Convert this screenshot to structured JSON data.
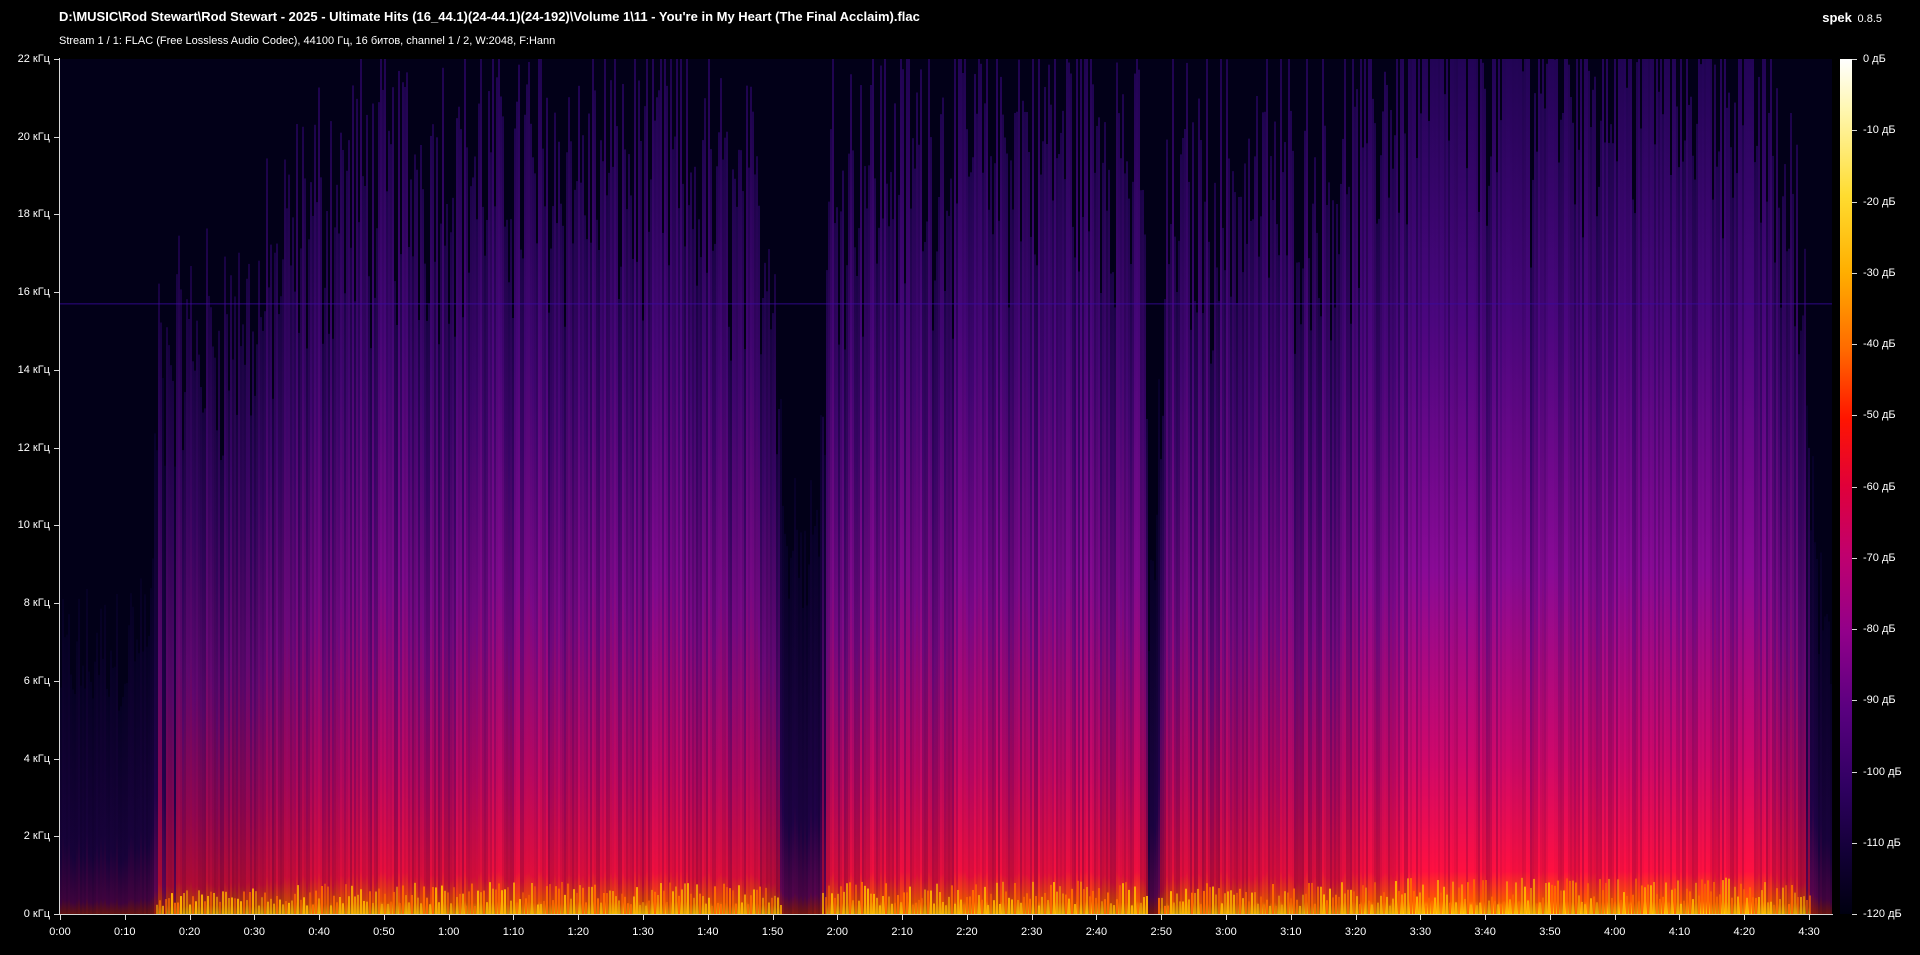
{
  "window": {
    "file_path": "D:\\MUSIC\\Rod Stewart\\Rod Stewart - 2025 - Ultimate Hits (16_44.1)(24-44.1)(24-192)\\Volume 1\\11 - You're in My Heart (The Final Acclaim).flac",
    "app_name": "spek",
    "app_version": "0.8.5",
    "stream_info": "Stream 1 / 1: FLAC (Free Lossless Audio Codec), 44100 Гц, 16 битов, channel 1 / 2, W:2048, F:Hann"
  },
  "frequency_axis": {
    "ticks": [
      {
        "value": 0,
        "label": "0 кГц"
      },
      {
        "value": 2,
        "label": "2 кГц"
      },
      {
        "value": 4,
        "label": "4 кГц"
      },
      {
        "value": 6,
        "label": "6 кГц"
      },
      {
        "value": 8,
        "label": "8 кГц"
      },
      {
        "value": 10,
        "label": "10 кГц"
      },
      {
        "value": 12,
        "label": "12 кГц"
      },
      {
        "value": 14,
        "label": "14 кГц"
      },
      {
        "value": 16,
        "label": "16 кГц"
      },
      {
        "value": 18,
        "label": "18 кГц"
      },
      {
        "value": 20,
        "label": "20 кГц"
      },
      {
        "value": 22,
        "label": "22 кГц"
      }
    ],
    "max_khz": 22
  },
  "time_axis": {
    "duration_s": 272,
    "ticks": [
      {
        "seconds": 0,
        "label": "0:00"
      },
      {
        "seconds": 10,
        "label": "0:10"
      },
      {
        "seconds": 20,
        "label": "0:20"
      },
      {
        "seconds": 30,
        "label": "0:30"
      },
      {
        "seconds": 40,
        "label": "0:40"
      },
      {
        "seconds": 50,
        "label": "0:50"
      },
      {
        "seconds": 60,
        "label": "1:00"
      },
      {
        "seconds": 70,
        "label": "1:10"
      },
      {
        "seconds": 80,
        "label": "1:20"
      },
      {
        "seconds": 90,
        "label": "1:30"
      },
      {
        "seconds": 100,
        "label": "1:40"
      },
      {
        "seconds": 110,
        "label": "1:50"
      },
      {
        "seconds": 120,
        "label": "2:00"
      },
      {
        "seconds": 130,
        "label": "2:10"
      },
      {
        "seconds": 140,
        "label": "2:20"
      },
      {
        "seconds": 150,
        "label": "2:30"
      },
      {
        "seconds": 160,
        "label": "2:40"
      },
      {
        "seconds": 170,
        "label": "2:50"
      },
      {
        "seconds": 180,
        "label": "3:00"
      },
      {
        "seconds": 190,
        "label": "3:10"
      },
      {
        "seconds": 200,
        "label": "3:20"
      },
      {
        "seconds": 210,
        "label": "3:30"
      },
      {
        "seconds": 220,
        "label": "3:40"
      },
      {
        "seconds": 230,
        "label": "3:50"
      },
      {
        "seconds": 240,
        "label": "4:00"
      },
      {
        "seconds": 250,
        "label": "4:10"
      },
      {
        "seconds": 260,
        "label": "4:20"
      },
      {
        "seconds": 270,
        "label": "4:30"
      }
    ]
  },
  "db_scale": {
    "ticks": [
      {
        "value": 0,
        "label": "0 дБ"
      },
      {
        "value": -10,
        "label": "-10 дБ"
      },
      {
        "value": -20,
        "label": "-20 дБ"
      },
      {
        "value": -30,
        "label": "-30 дБ"
      },
      {
        "value": -40,
        "label": "-40 дБ"
      },
      {
        "value": -50,
        "label": "-50 дБ"
      },
      {
        "value": -60,
        "label": "-60 дБ"
      },
      {
        "value": -70,
        "label": "-70 дБ"
      },
      {
        "value": -80,
        "label": "-80 дБ"
      },
      {
        "value": -90,
        "label": "-90 дБ"
      },
      {
        "value": -100,
        "label": "-100 дБ"
      },
      {
        "value": -110,
        "label": "-110 дБ"
      },
      {
        "value": -120,
        "label": "-120 дБ"
      }
    ],
    "min_db": -120,
    "max_db": 0
  },
  "spectrogram": {
    "colors": {
      "background": "#020018",
      "low": "#1a0050",
      "mid": "#8a0c9a",
      "high": "#e0103a",
      "peak": "#ffb000"
    },
    "energy_profile": [
      {
        "seconds": 0,
        "intensity": 0.15
      },
      {
        "seconds": 14,
        "intensity": 0.2
      },
      {
        "seconds": 15,
        "intensity": 0.55
      },
      {
        "seconds": 30,
        "intensity": 0.6
      },
      {
        "seconds": 40,
        "intensity": 0.75
      },
      {
        "seconds": 60,
        "intensity": 0.8
      },
      {
        "seconds": 95,
        "intensity": 0.8
      },
      {
        "seconds": 110,
        "intensity": 0.7
      },
      {
        "seconds": 112,
        "intensity": 0.3
      },
      {
        "seconds": 117,
        "intensity": 0.35
      },
      {
        "seconds": 119,
        "intensity": 0.8
      },
      {
        "seconds": 160,
        "intensity": 0.85
      },
      {
        "seconds": 167,
        "intensity": 0.8
      },
      {
        "seconds": 168,
        "intensity": 0.25
      },
      {
        "seconds": 169,
        "intensity": 0.3
      },
      {
        "seconds": 171,
        "intensity": 0.75
      },
      {
        "seconds": 200,
        "intensity": 0.8
      },
      {
        "seconds": 208,
        "intensity": 0.95
      },
      {
        "seconds": 260,
        "intensity": 0.95
      },
      {
        "seconds": 268,
        "intensity": 0.7
      },
      {
        "seconds": 272,
        "intensity": 0.2
      }
    ],
    "cutoff_line_khz": 15.7
  }
}
